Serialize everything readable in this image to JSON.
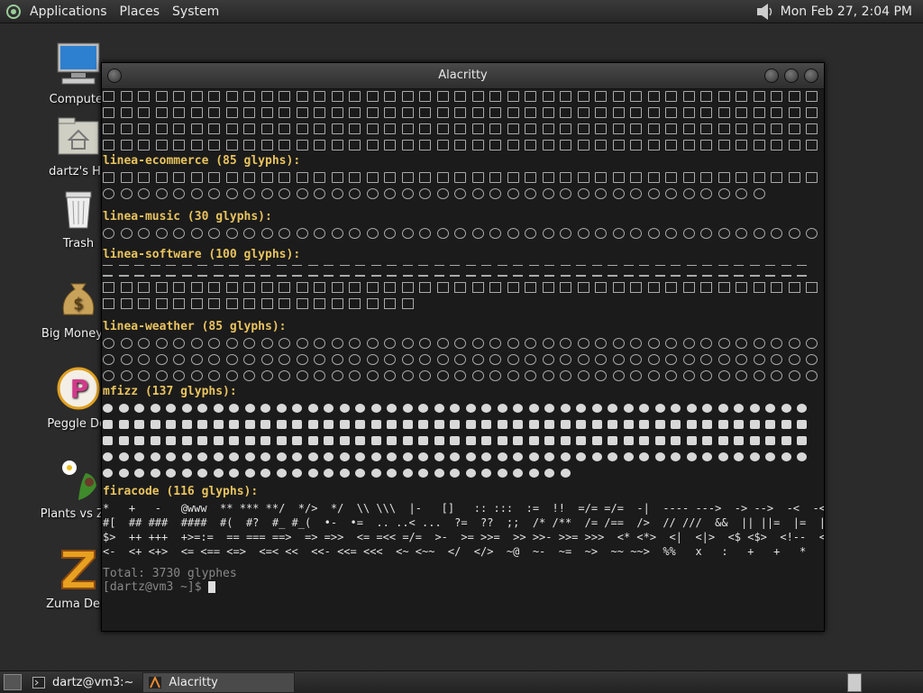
{
  "top_panel": {
    "menus": [
      "Applications",
      "Places",
      "System"
    ],
    "clock": "Mon Feb 27,  2:04 PM"
  },
  "desktop_icons": [
    {
      "label": "Computer",
      "icon": "computer-icon"
    },
    {
      "label": "dartz's Ho",
      "icon": "home-folder-icon"
    },
    {
      "label": "Trash",
      "icon": "trash-icon"
    },
    {
      "label": "Big Money D",
      "icon": "money-bag-icon"
    },
    {
      "label": "Peggle Del",
      "icon": "peggle-icon"
    },
    {
      "label": "Plants vs Zor",
      "icon": "plants-icon"
    },
    {
      "label": "Zuma Delu",
      "icon": "zuma-icon"
    }
  ],
  "window": {
    "title": "Alacritty"
  },
  "terminal": {
    "sections": [
      {
        "header": "linea-ecommerce (85 glyphs):"
      },
      {
        "header": "linea-music (30 glyphs):"
      },
      {
        "header": "linea-software (100 glyphs):"
      },
      {
        "header": "linea-weather (85 glyphs):"
      },
      {
        "header": "mfizz (137 glyphs):"
      },
      {
        "header": "firacode (116 glyphs):"
      }
    ],
    "fira_rows": [
      "*   +   -   @www  ** *** **/  */>  */  \\\\ \\\\\\  |-   []   :: :::  :=  !!  =/= =/=  -|  ---- --->  -> -->  -<  -<<  -~  #{",
      "#[  ## ###  ####  #(  #?  #_ #_(  •-  •=  .. ..< ...  ?=  ??  ;;  /* /**  /= /==  />  // ///  &&  || ||=  |=  |>  ^=",
      "$>  ++ +++  +>=:=  == === ==>  => =>>  <= =<< =/=  >-  >= >>=  >> >>- >>= >>>  <* <*>  <|  <|>  <$ <$>  <!--  <- <--",
      "<-  <+ <+>  <= <== <=>  <=< <<  <<- <<= <<<  <~ <~~  </  </>  ~@  ~-  ~=  ~>  ~~ ~~>  %%   x   :   +   +   *"
    ],
    "total": "Total: 3730 glyphes",
    "prompt": "[dartz@vm3 ~]$ "
  },
  "bottom_panel": {
    "tasks": [
      {
        "label": "dartz@vm3:~",
        "active": false
      },
      {
        "label": "Alacritty",
        "active": true
      }
    ]
  },
  "colors": {
    "header": "#e9c35e",
    "terminal_bg": "#1b1b1b",
    "desktop_bg": "#2b2b2b"
  }
}
